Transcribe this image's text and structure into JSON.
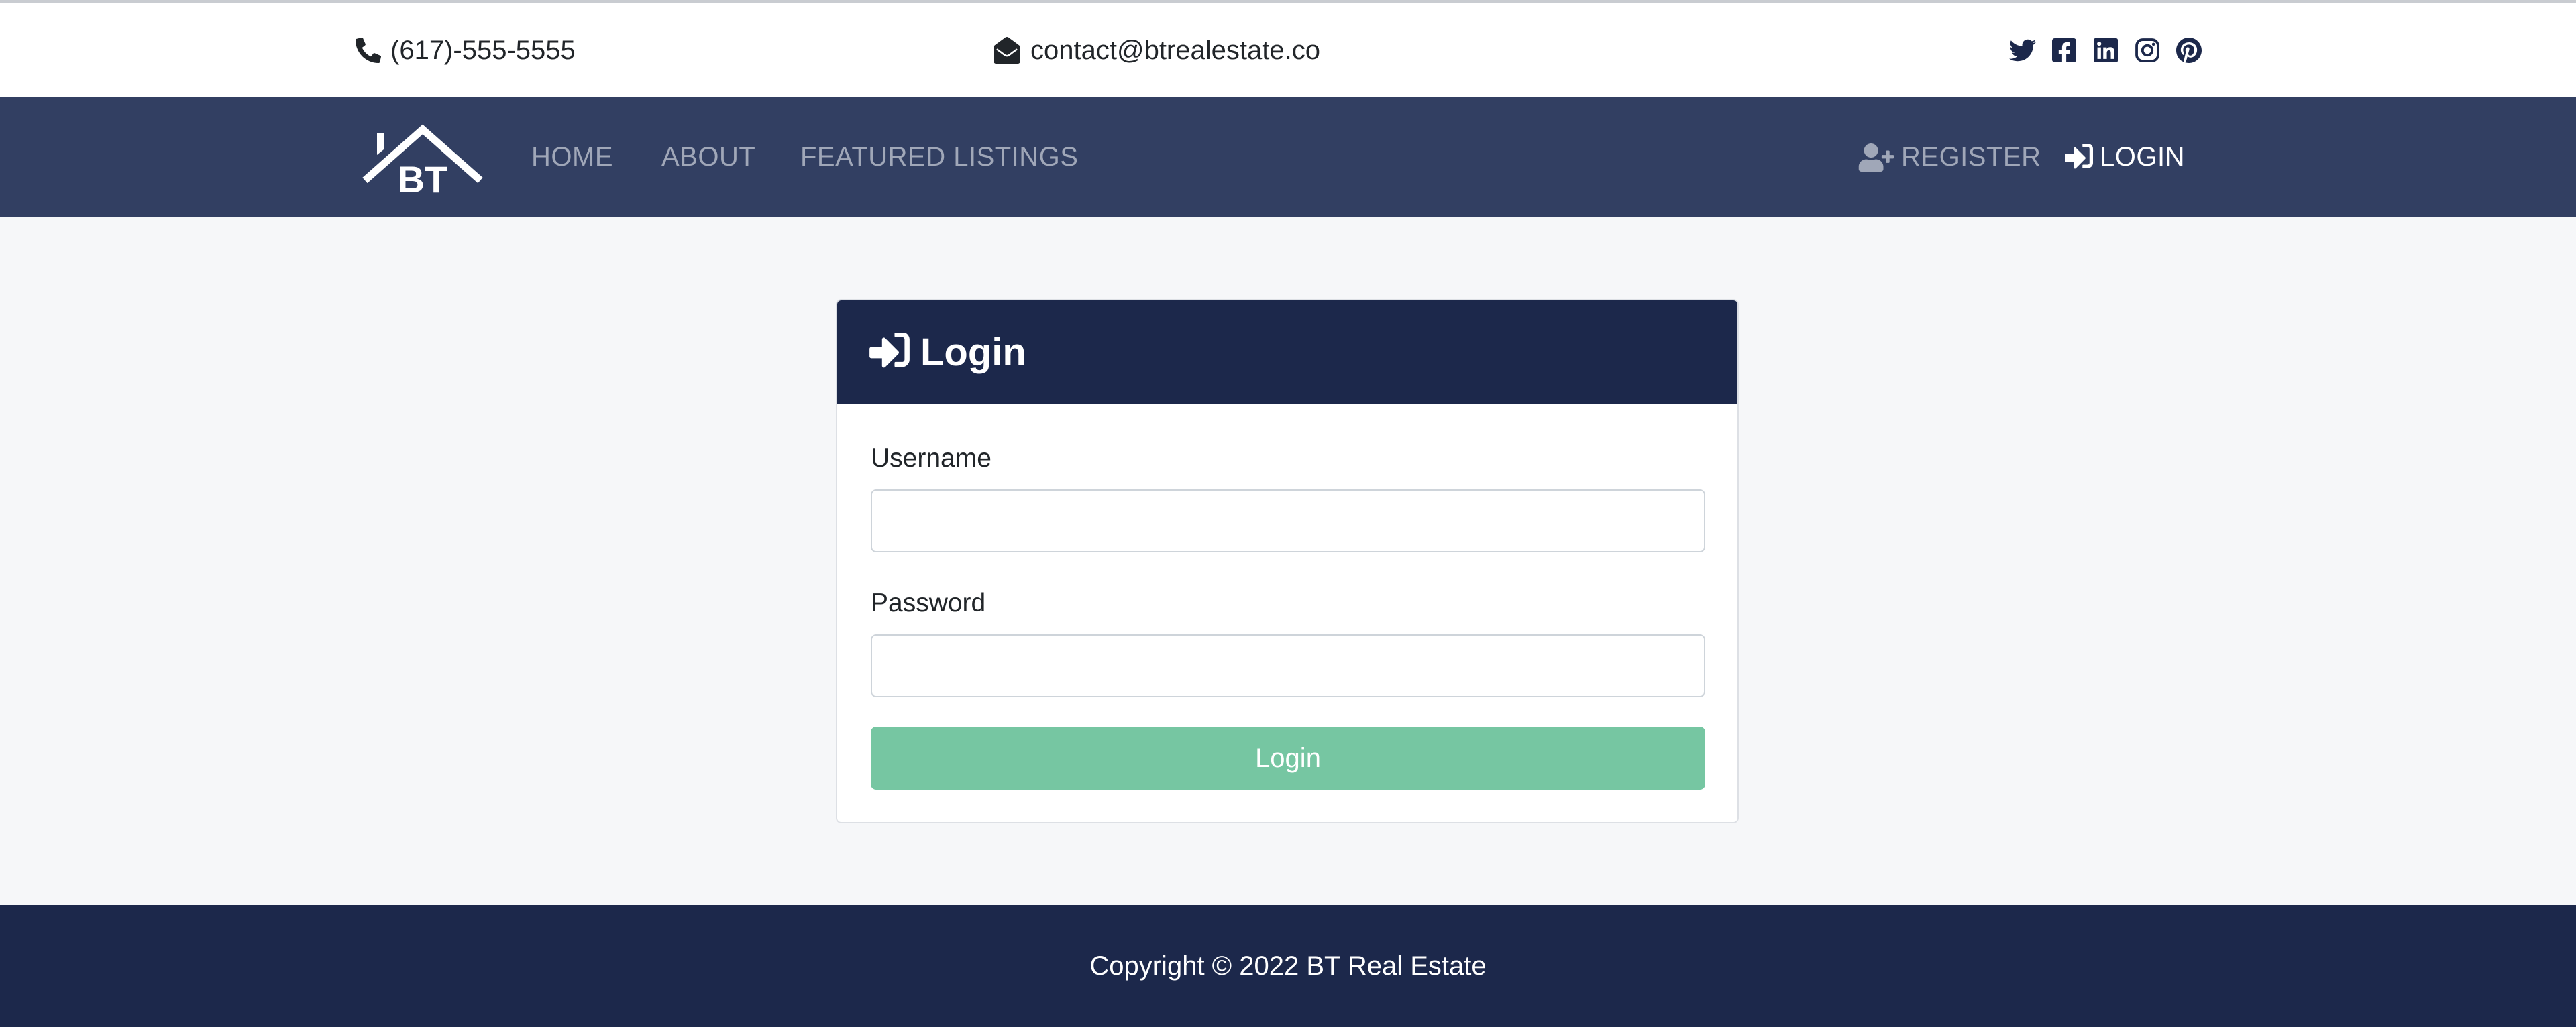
{
  "topbar": {
    "phone": "(617)-555-5555",
    "phone_icon": "phone-icon",
    "email": "contact@btrealestate.co",
    "email_icon": "envelope-open-icon",
    "socials": [
      "twitter-icon",
      "facebook-icon",
      "linkedin-icon",
      "instagram-icon",
      "pinterest-icon"
    ]
  },
  "navbar": {
    "brand": {
      "logo_text": "BT",
      "logo_icon": "house-roof-logo"
    },
    "links": [
      {
        "label": "HOME"
      },
      {
        "label": "ABOUT"
      },
      {
        "label": "FEATURED LISTINGS"
      }
    ],
    "register": {
      "label": "REGISTER",
      "icon": "user-plus-icon"
    },
    "login": {
      "label": "LOGIN",
      "icon": "sign-in-icon",
      "active": true
    }
  },
  "login_card": {
    "title": "Login",
    "title_icon": "sign-in-icon",
    "username_label": "Username",
    "username_value": "",
    "password_label": "Password",
    "password_value": "",
    "submit_label": "Login"
  },
  "footer": {
    "copyright": "Copyright © 2022 BT Real Estate"
  },
  "colors": {
    "top_bar_bg": "#ffffff",
    "navbar_bg": "#323f62",
    "card_header_bg": "#1c284b",
    "footer_bg": "#1c284b",
    "page_bg": "#f6f7f9",
    "submit_button_bg": "#76c6a2",
    "social_icon_color": "#1c284b",
    "nav_inactive_text": "#a0a7b8",
    "nav_active_text": "#ffffff"
  }
}
